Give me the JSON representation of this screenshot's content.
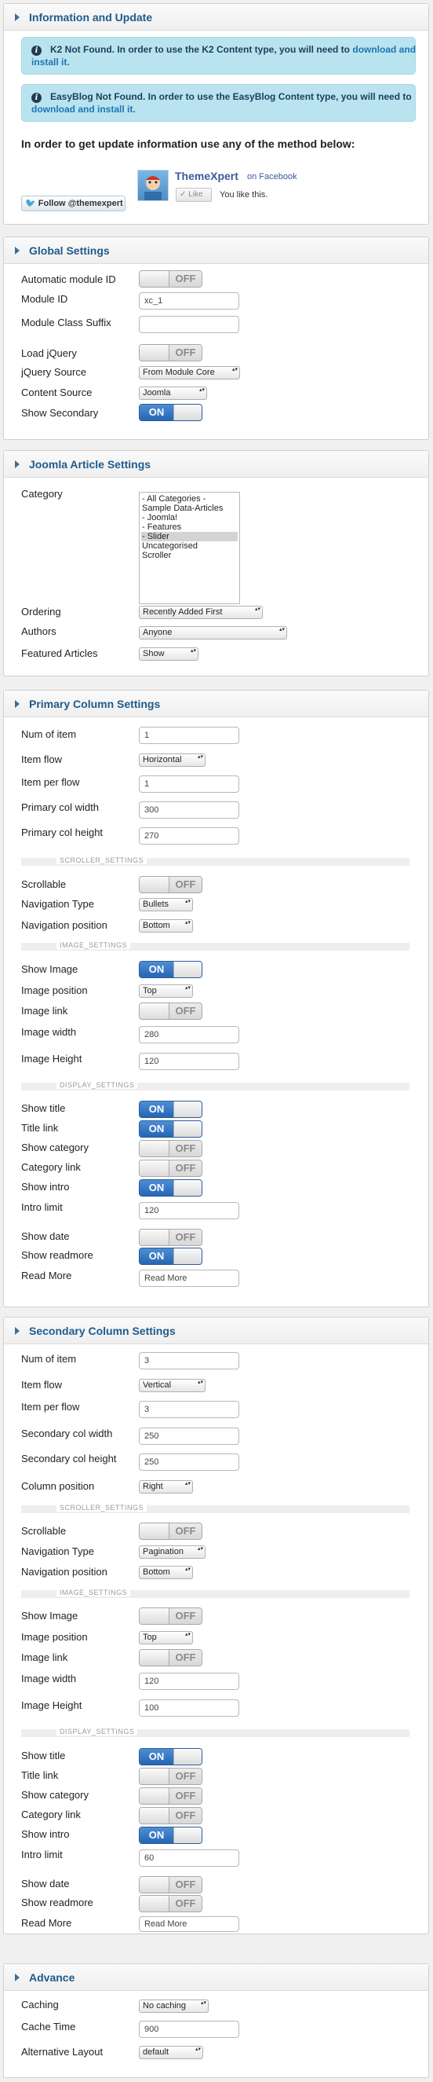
{
  "info": {
    "title": "Information and Update",
    "alerts": [
      {
        "icon": "info-icon",
        "text": "K2 Not Found. In order to use the K2 Content type, you will need to",
        "link_a": "download and",
        "link_b": "install it."
      },
      {
        "icon": "info-icon",
        "text": "EasyBlog Not Found. In order to use the EasyBlog Content type, you will need to",
        "link_a": "download and install it.",
        "link_b": ""
      }
    ],
    "update_text": "In order to get update information use any of the method below:",
    "fb_name": "ThemeXpert",
    "fb_on": "on Facebook",
    "like_label": "Like",
    "you_like": "You like this.",
    "follow_label": "Follow @themexpert"
  },
  "global": {
    "title": "Global Settings",
    "auto_id_label": "Automatic module ID",
    "auto_id_state": "OFF",
    "module_id_label": "Module ID",
    "module_id_value": "xc_1",
    "suffix_label": "Module Class Suffix",
    "suffix_value": "",
    "load_jq_label": "Load jQuery",
    "load_jq_state": "OFF",
    "jq_source_label": "jQuery Source",
    "jq_source_value": "From Module Core",
    "content_source_label": "Content Source",
    "content_source_value": "Joomla",
    "show_secondary_label": "Show Secondary",
    "show_secondary_state": "ON"
  },
  "article": {
    "title": "Joomla Article Settings",
    "category_label": "Category",
    "categories": [
      "- All Categories -",
      "Sample Data-Articles",
      "- Joomla!",
      "- Features",
      "- Slider",
      "Uncategorised",
      "Scroller"
    ],
    "selected_category_index": 4,
    "ordering_label": "Ordering",
    "ordering_value": "Recently Added First",
    "authors_label": "Authors",
    "authors_value": "Anyone",
    "featured_label": "Featured Articles",
    "featured_value": "Show"
  },
  "primary": {
    "title": "Primary Column Settings",
    "num_label": "Num of item",
    "num_value": "1",
    "flow_label": "Item flow",
    "flow_value": "Horizontal",
    "per_flow_label": "Item per flow",
    "per_flow_value": "1",
    "width_label": "Primary col width",
    "width_value": "300",
    "height_label": "Primary col height",
    "height_value": "270",
    "scroller_sep": "SCROLLER_SETTINGS",
    "scrollable_label": "Scrollable",
    "scrollable_state": "OFF",
    "nav_type_label": "Navigation Type",
    "nav_type_value": "Bullets",
    "nav_pos_label": "Navigation position",
    "nav_pos_value": "Bottom",
    "image_sep": "IMAGE_SETTINGS",
    "show_image_label": "Show Image",
    "show_image_state": "ON",
    "image_pos_label": "Image position",
    "image_pos_value": "Top",
    "image_link_label": "Image link",
    "image_link_state": "OFF",
    "image_width_label": "Image width",
    "image_width_value": "280",
    "image_height_label": "Image Height",
    "image_height_value": "120",
    "display_sep": "DISPLAY_SETTINGS",
    "show_title_label": "Show title",
    "show_title_state": "ON",
    "title_link_label": "Title link",
    "title_link_state": "ON",
    "show_cat_label": "Show category",
    "show_cat_state": "OFF",
    "cat_link_label": "Category link",
    "cat_link_state": "OFF",
    "show_intro_label": "Show intro",
    "show_intro_state": "ON",
    "intro_limit_label": "Intro limit",
    "intro_limit_value": "120",
    "show_date_label": "Show date",
    "show_date_state": "OFF",
    "show_more_label": "Show readmore",
    "show_more_state": "ON",
    "read_more_label": "Read More",
    "read_more_value": "Read More"
  },
  "secondary": {
    "title": "Secondary Column Settings",
    "num_label": "Num of item",
    "num_value": "3",
    "flow_label": "Item flow",
    "flow_value": "Vertical",
    "per_flow_label": "Item per flow",
    "per_flow_value": "3",
    "width_label": "Secondary col width",
    "width_value": "250",
    "height_label": "Secondary col height",
    "height_value": "250",
    "col_pos_label": "Column position",
    "col_pos_value": "Right",
    "scroller_sep": "SCROLLER_SETTINGS",
    "scrollable_label": "Scrollable",
    "scrollable_state": "OFF",
    "nav_type_label": "Navigation Type",
    "nav_type_value": "Pagination",
    "nav_pos_label": "Navigation position",
    "nav_pos_value": "Bottom",
    "image_sep": "IMAGE_SETTINGS",
    "show_image_label": "Show Image",
    "show_image_state": "OFF",
    "image_pos_label": "Image position",
    "image_pos_value": "Top",
    "image_link_label": "Image link",
    "image_link_state": "OFF",
    "image_width_label": "Image width",
    "image_width_value": "120",
    "image_height_label": "Image Height",
    "image_height_value": "100",
    "display_sep": "DISPLAY_SETTINGS",
    "show_title_label": "Show title",
    "show_title_state": "ON",
    "title_link_label": "Title link",
    "title_link_state": "OFF",
    "show_cat_label": "Show category",
    "show_cat_state": "OFF",
    "cat_link_label": "Category link",
    "cat_link_state": "OFF",
    "show_intro_label": "Show intro",
    "show_intro_state": "ON",
    "intro_limit_label": "Intro limit",
    "intro_limit_value": "60",
    "show_date_label": "Show date",
    "show_date_state": "OFF",
    "show_more_label": "Show readmore",
    "show_more_state": "OFF",
    "read_more_label": "Read More",
    "read_more_value": "Read More"
  },
  "advance": {
    "title": "Advance",
    "caching_label": "Caching",
    "caching_value": "No caching",
    "cache_time_label": "Cache Time",
    "cache_time_value": "900",
    "alt_layout_label": "Alternative Layout",
    "alt_layout_value": "default"
  }
}
